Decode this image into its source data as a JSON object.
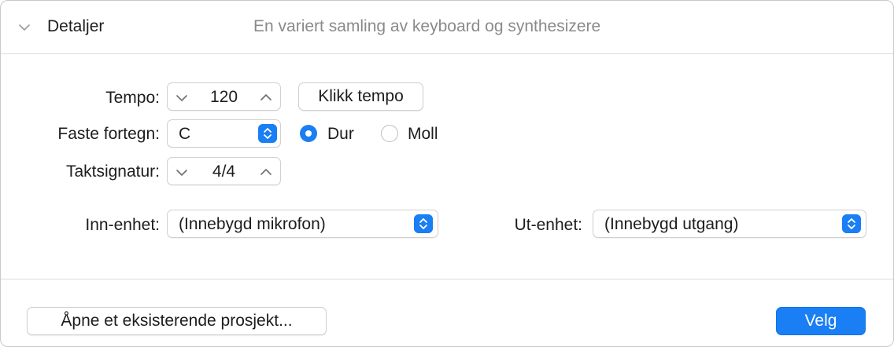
{
  "header": {
    "title": "Detaljer",
    "description": "En variert samling av keyboard og synthesizere"
  },
  "tempo": {
    "label": "Tempo:",
    "value": "120",
    "tap_button": "Klikk tempo"
  },
  "key": {
    "label": "Faste fortegn:",
    "value": "C",
    "modes": [
      {
        "label": "Dur",
        "selected": true
      },
      {
        "label": "Moll",
        "selected": false
      }
    ]
  },
  "time_signature": {
    "label": "Taktsignatur:",
    "value": "4/4"
  },
  "input_device": {
    "label": "Inn-enhet:",
    "value": "(Innebygd mikrofon)"
  },
  "output_device": {
    "label": "Ut-enhet:",
    "value": "(Innebygd utgang)"
  },
  "footer": {
    "open_existing": "Åpne et eksisterende prosjekt...",
    "choose": "Velg"
  },
  "colors": {
    "accent": "#1a7ef5",
    "secondary_text": "#8a8a8a"
  }
}
